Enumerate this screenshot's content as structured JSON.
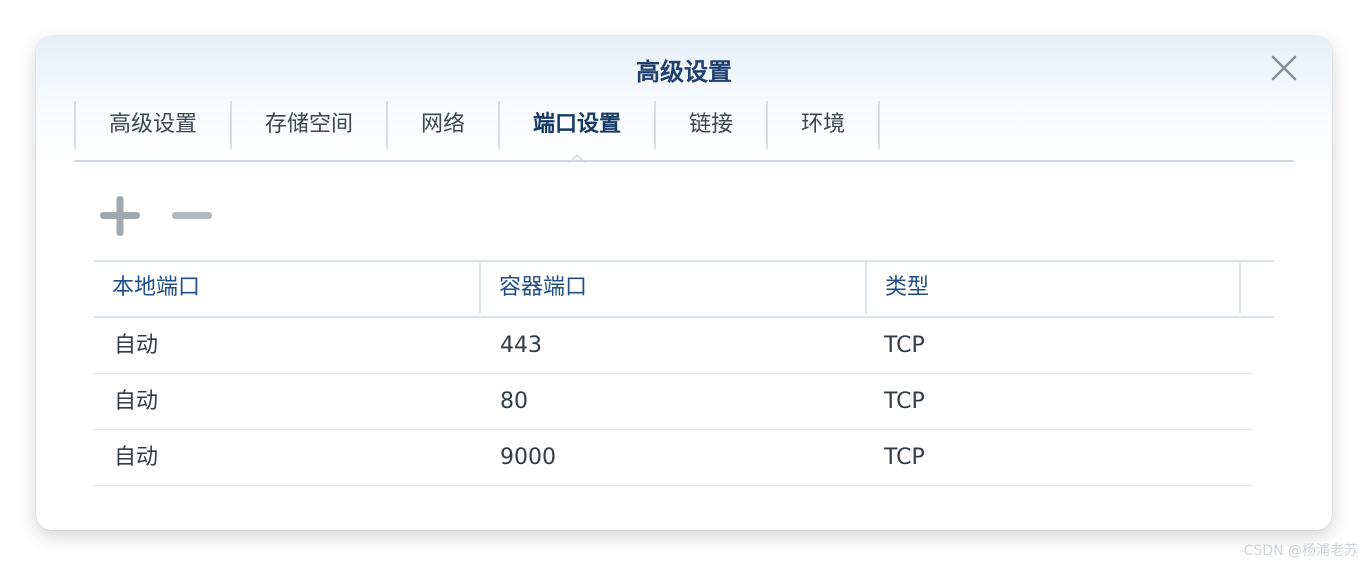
{
  "dialog": {
    "title": "高级设置",
    "close_icon": "close-icon"
  },
  "tabs": [
    {
      "label": "高级设置",
      "active": false
    },
    {
      "label": "存储空间",
      "active": false
    },
    {
      "label": "网络",
      "active": false
    },
    {
      "label": "端口设置",
      "active": true
    },
    {
      "label": "链接",
      "active": false
    },
    {
      "label": "环境",
      "active": false
    }
  ],
  "toolbar": {
    "add_icon": "plus-icon",
    "remove_icon": "minus-icon"
  },
  "table": {
    "headers": [
      "本地端口",
      "容器端口",
      "类型"
    ],
    "rows": [
      [
        "自动",
        "443",
        "TCP"
      ],
      [
        "自动",
        "80",
        "TCP"
      ],
      [
        "自动",
        "9000",
        "TCP"
      ]
    ]
  },
  "watermark": "CSDN @杨浦老苏",
  "colors": {
    "title": "#1f3f6e",
    "header_text": "#1f4f86",
    "border": "#dbe2ea"
  }
}
